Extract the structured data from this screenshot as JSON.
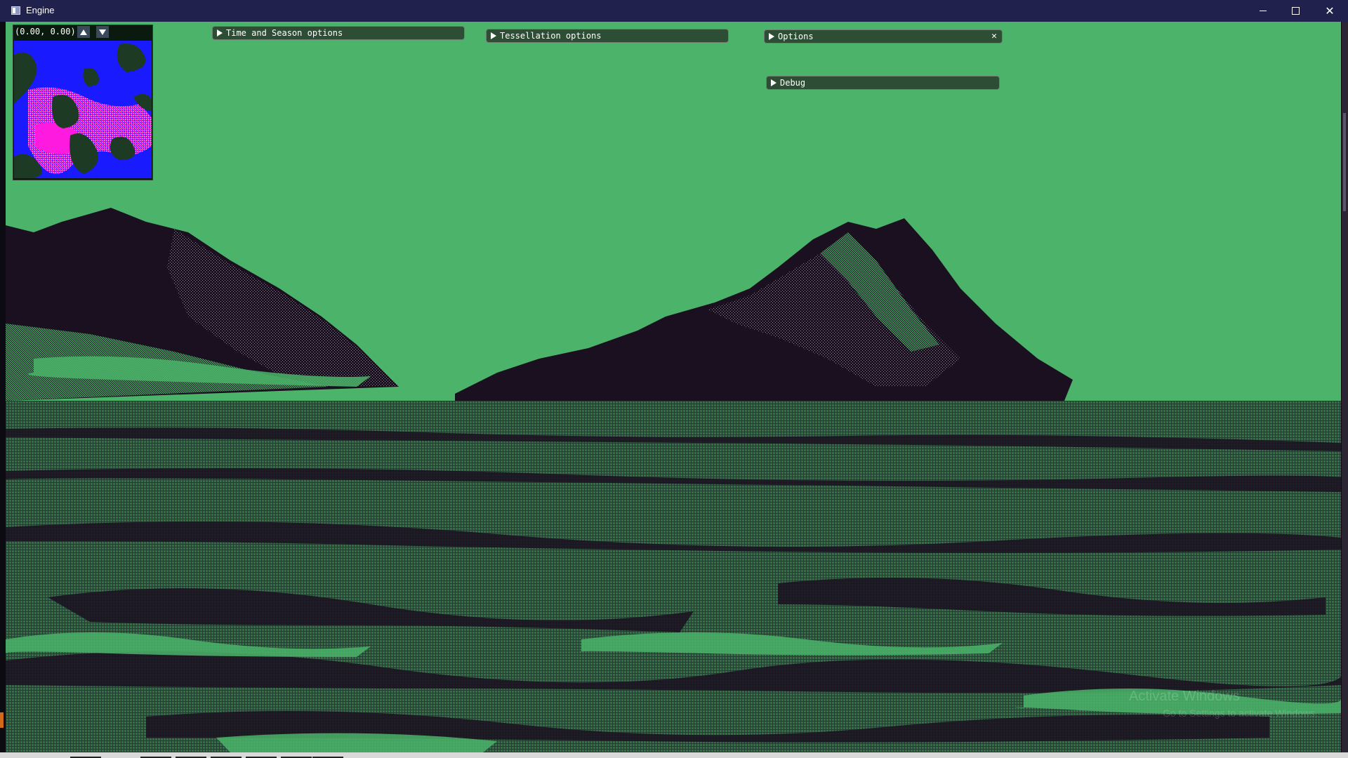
{
  "window": {
    "title": "Engine",
    "icon": "app-window-icon",
    "controls": {
      "minimize_icon": "minimize-icon",
      "maximize_icon": "maximize-icon",
      "close_icon": "close-icon",
      "close_glyph": "✕"
    }
  },
  "minimap": {
    "coords": "(0.00, 0.00)",
    "up_icon": "arrow-up-icon",
    "down_icon": "arrow-down-icon"
  },
  "panels": {
    "time_season": {
      "label": "Time and Season options",
      "collapsed": true
    },
    "tessellation": {
      "label": "Tessellation options",
      "collapsed": true
    },
    "options": {
      "label": "Options",
      "collapsed": true,
      "close_glyph": "✕"
    },
    "debug": {
      "label": "Debug",
      "collapsed": true
    }
  },
  "watermark": {
    "title": "Activate Windows",
    "subtitle": "Go to Settings to activate Windows."
  },
  "colors": {
    "sky": "#4bb46a",
    "terrain_dark": "#1a1020",
    "panel_header": "#2d4e34",
    "titlebar": "#21214e",
    "minimap_blue": "#1a1aff",
    "minimap_magenta": "#ff1ae0"
  }
}
